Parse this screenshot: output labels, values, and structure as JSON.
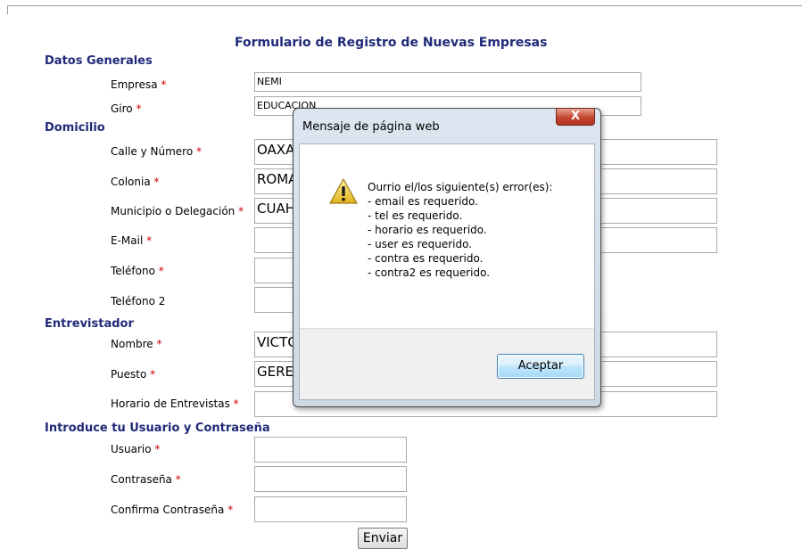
{
  "form": {
    "title": "Formulario de Registro de Nuevas Empresas",
    "required_mark": "*",
    "sections": {
      "generales": "Datos Generales",
      "domicilio": "Domicilio",
      "entrevistador": "Entrevistador",
      "usuario": "Introduce tu Usuario y Contraseña"
    },
    "labels": {
      "empresa": "Empresa",
      "giro": "Giro",
      "calle": "Calle y Número",
      "colonia": "Colonia",
      "municipio": "Municipio o Delegación",
      "email": "E-Mail",
      "telefono": "Teléfono",
      "telefono2": "Teléfono 2",
      "nombre": "Nombre",
      "puesto": "Puesto",
      "horario": "Horario de Entrevistas",
      "usuario": "Usuario",
      "contrasena": "Contraseña",
      "confirma": "Confirma Contraseña"
    },
    "values": {
      "empresa": "NEMI",
      "giro": "EDUCACION",
      "calle": "OAXA",
      "colonia": "ROMA",
      "municipio": "CUAH",
      "email": "",
      "telefono": "",
      "telefono2": "",
      "nombre": "VICTO",
      "puesto": "GERE",
      "horario": "",
      "usuario": "",
      "contrasena": "",
      "confirma": ""
    },
    "submit_label": "Enviar"
  },
  "dialog": {
    "title": "Mensaje de página web",
    "close_label": "X",
    "icon": "warning-icon",
    "message_lines": [
      "Ourrio el/los siguiente(s) error(es):",
      "- email es requerido.",
      "- tel es requerido.",
      "- horario es requerido.",
      "- user es requerido.",
      "- contra es requerido.",
      "- contra2 es requerido."
    ],
    "ok_label": "Aceptar"
  }
}
